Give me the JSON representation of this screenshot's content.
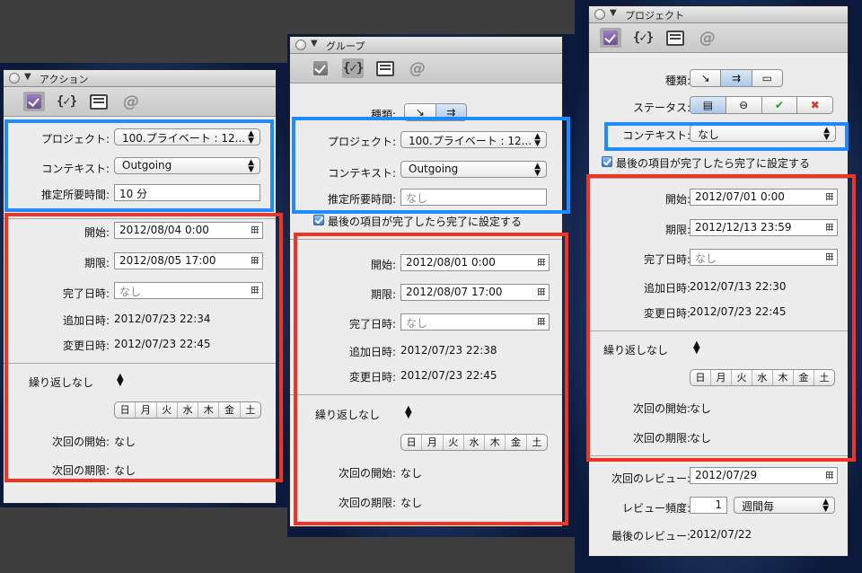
{
  "colors": {
    "highlight_blue": "#1e8bff",
    "highlight_red": "#f03322",
    "accent_check": "#7a58a4"
  },
  "toolbar_icons": [
    "check-icon",
    "context-brace-icon",
    "note-sheet-icon",
    "at-sign-icon"
  ],
  "common": {
    "repeat": "繰り返しなし",
    "days": [
      "日",
      "月",
      "火",
      "水",
      "木",
      "金",
      "土"
    ],
    "none": "なし"
  },
  "action": {
    "title": "アクション",
    "project_label": "プロジェクト:",
    "project_value": "100.プライベート : 12...",
    "context_label": "コンテキスト:",
    "context_value": "Outgoing",
    "duration_label": "推定所要時間:",
    "duration_value": "10 分",
    "start_label": "開始:",
    "start_value": "2012/08/04 0:00",
    "due_label": "期限:",
    "due_value": "2012/08/05 17:00",
    "done_label": "完了日時:",
    "done_value": "なし",
    "added_label": "追加日時:",
    "added_value": "2012/07/23 22:34",
    "changed_label": "変更日時:",
    "changed_value": "2012/07/23 22:45",
    "next_start_label": "次回の開始:",
    "next_start_value": "なし",
    "next_due_label": "次回の期限:",
    "next_due_value": "なし"
  },
  "group": {
    "title": "グループ",
    "kind_label": "種類:",
    "project_label": "プロジェクト:",
    "project_value": "100.プライベート : 12...",
    "context_label": "コンテキスト:",
    "context_value": "Outgoing",
    "duration_label": "推定所要時間:",
    "duration_value": "なし",
    "complete_last": "最後の項目が完了したら完了に設定する",
    "start_label": "開始:",
    "start_value": "2012/08/01 0:00",
    "due_label": "期限:",
    "due_value": "2012/08/07 17:00",
    "done_label": "完了日時:",
    "done_value": "なし",
    "added_label": "追加日時:",
    "added_value": "2012/07/23 22:38",
    "changed_label": "変更日時:",
    "changed_value": "2012/07/23 22:45",
    "next_start_label": "次回の開始:",
    "next_start_value": "なし",
    "next_due_label": "次回の期限:",
    "next_due_value": "なし"
  },
  "project": {
    "title": "プロジェクト",
    "kind_label": "種類:",
    "status_label": "ステータス:",
    "context_label": "コンテキスト:",
    "context_value": "なし",
    "complete_last": "最後の項目が完了したら完了に設定する",
    "start_label": "開始:",
    "start_value": "2012/07/01 0:00",
    "due_label": "期限:",
    "due_value": "2012/12/13 23:59",
    "done_label": "完了日時:",
    "done_value": "なし",
    "added_label": "追加日時:",
    "added_value": "2012/07/13 22:30",
    "changed_label": "変更日時:",
    "changed_value": "2012/07/23 22:45",
    "next_start_label": "次回の開始:",
    "next_start_value": "なし",
    "next_due_label": "次回の期限:",
    "next_due_value": "なし",
    "next_review_label": "次回のレビュー:",
    "next_review_value": "2012/07/29",
    "review_freq_label": "レビュー頻度:",
    "review_freq_value": "1",
    "review_freq_unit": "週間毎",
    "last_review_label": "最後のレビュー:",
    "last_review_value": "2012/07/22"
  }
}
